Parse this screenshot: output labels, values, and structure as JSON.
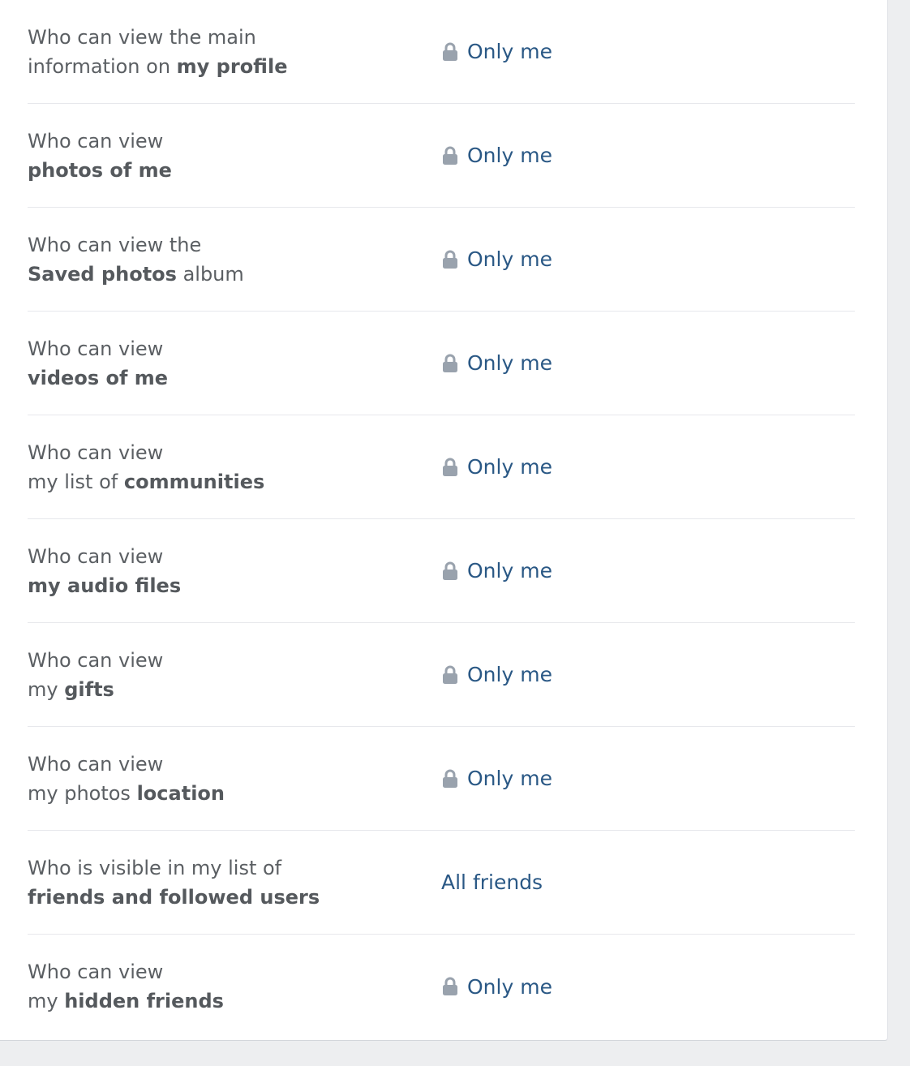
{
  "colors": {
    "link": "#2a5885",
    "label": "#5b5f63",
    "lock": "#99a2ad",
    "divider": "#e7e8ec",
    "background": "#edeef0",
    "panel": "#ffffff"
  },
  "settings": [
    {
      "line1": "Who can view the main",
      "line2_pre": "information on ",
      "line2_bold": "my profile",
      "line2_post": "",
      "value": "Only me",
      "icon": "lock-icon"
    },
    {
      "line1": "Who can view",
      "line2_pre": "",
      "line2_bold": "photos of me",
      "line2_post": "",
      "value": "Only me",
      "icon": "lock-icon"
    },
    {
      "line1": "Who can view the",
      "line2_pre": "",
      "line2_bold": "Saved photos",
      "line2_post": " album",
      "value": "Only me",
      "icon": "lock-icon"
    },
    {
      "line1": "Who can view",
      "line2_pre": "",
      "line2_bold": "videos of me",
      "line2_post": "",
      "value": "Only me",
      "icon": "lock-icon"
    },
    {
      "line1": "Who can view",
      "line2_pre": "my list of ",
      "line2_bold": "communities",
      "line2_post": "",
      "value": "Only me",
      "icon": "lock-icon"
    },
    {
      "line1": "Who can view",
      "line2_pre": "",
      "line2_bold": "my audio files",
      "line2_post": "",
      "value": "Only me",
      "icon": "lock-icon"
    },
    {
      "line1": "Who can view",
      "line2_pre": "my ",
      "line2_bold": "gifts",
      "line2_post": "",
      "value": "Only me",
      "icon": "lock-icon"
    },
    {
      "line1": "Who can view",
      "line2_pre": "my photos ",
      "line2_bold": "location",
      "line2_post": "",
      "value": "Only me",
      "icon": "lock-icon"
    },
    {
      "line1": "Who is visible in my list of",
      "line2_pre": "",
      "line2_bold": "friends and followed users",
      "line2_post": "",
      "value": "All friends",
      "icon": ""
    },
    {
      "line1": "Who can view",
      "line2_pre": "my ",
      "line2_bold": "hidden friends",
      "line2_post": "",
      "value": "Only me",
      "icon": "lock-icon"
    }
  ]
}
